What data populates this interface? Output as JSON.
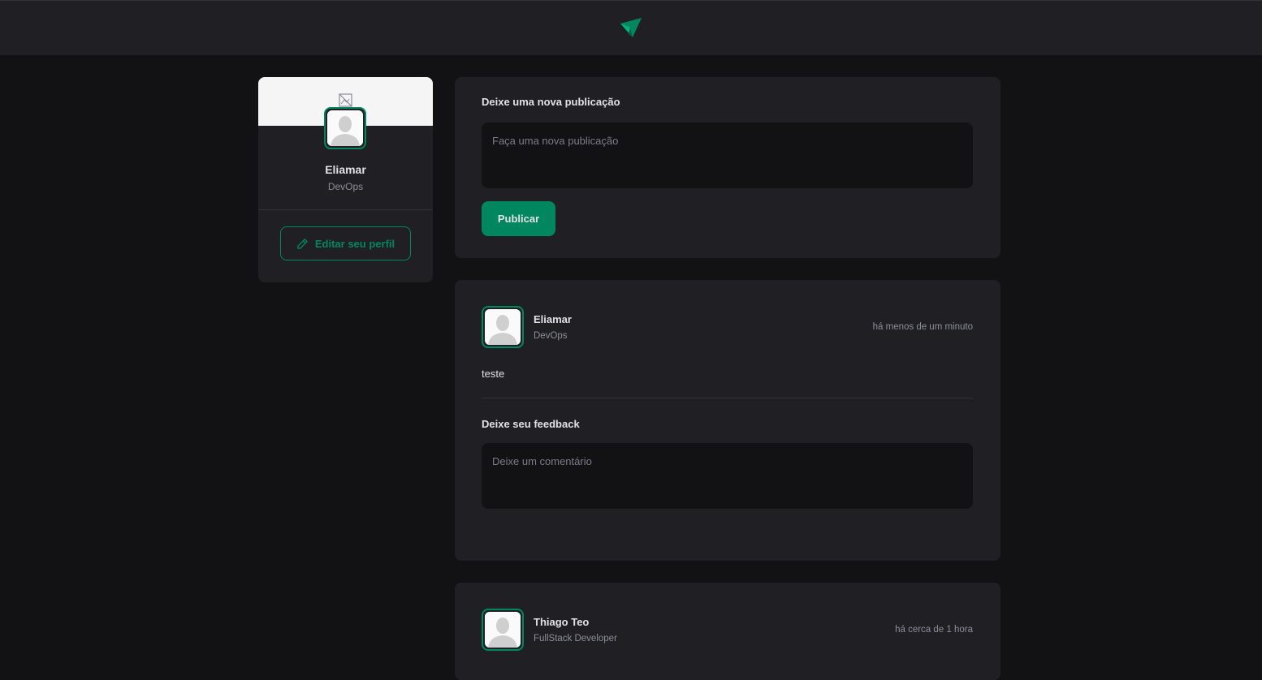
{
  "header": {
    "logo_icon": "ignite-feed-logo"
  },
  "profile": {
    "cover_icon": "broken-image-icon",
    "name": "Eliamar",
    "role": "DevOps",
    "edit_label": "Editar seu perfil",
    "edit_icon": "pencil-icon"
  },
  "new_post": {
    "title": "Deixe uma nova publicação",
    "placeholder": "Faça uma nova publicação",
    "publish_label": "Publicar"
  },
  "posts": [
    {
      "author": "Eliamar",
      "role": "DevOps",
      "time": "há menos de um minuto",
      "content": "teste",
      "feedback_title": "Deixe seu feedback",
      "comment_placeholder": "Deixe um comentário"
    },
    {
      "author": "Thiago Teo",
      "role": "FullStack Developer",
      "time": "há cerca de 1 hora"
    }
  ],
  "colors": {
    "accent": "#00875f",
    "background": "#121214",
    "card": "#202024"
  }
}
